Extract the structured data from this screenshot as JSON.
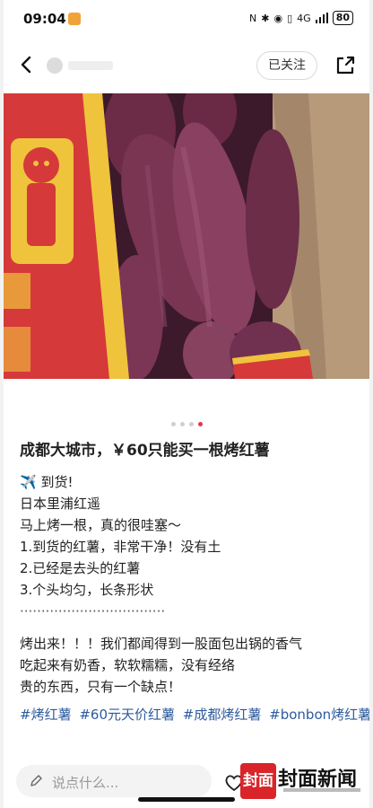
{
  "status_bar": {
    "time": "09:04",
    "network": "4G",
    "battery": "80"
  },
  "nav": {
    "follow_label": "已关注"
  },
  "photo": {
    "slide_count": 4,
    "active_slide": 4
  },
  "post": {
    "title": "成都大城市，￥60只能买一根烤红薯",
    "lines": [
      "✈️ 到货!",
      "日本里浦红遥",
      "马上烤一根，真的很哇塞～",
      "1.到货的红薯，非常干净！没有土",
      "2.已经是去头的红薯",
      "3.个头均匀，长条形状",
      "··································"
    ],
    "lines2": [
      "烤出来！！！我们都闻得到一股面包出锅的香气",
      "吃起来有奶香，软软糯糯，没有经络",
      "贵的东西，只有一个缺点！"
    ],
    "tags": [
      "#烤红薯",
      "#60元天价红薯",
      "#成都烤红薯",
      "#bonbon烤红薯"
    ]
  },
  "bottom_bar": {
    "comment_placeholder": "说点什么..."
  },
  "watermark": {
    "badge": "封面",
    "name": "封面新闻"
  },
  "colors": {
    "accent": "#e8344e",
    "tag": "#2d5b9c",
    "watermark_red": "#d9252a"
  }
}
